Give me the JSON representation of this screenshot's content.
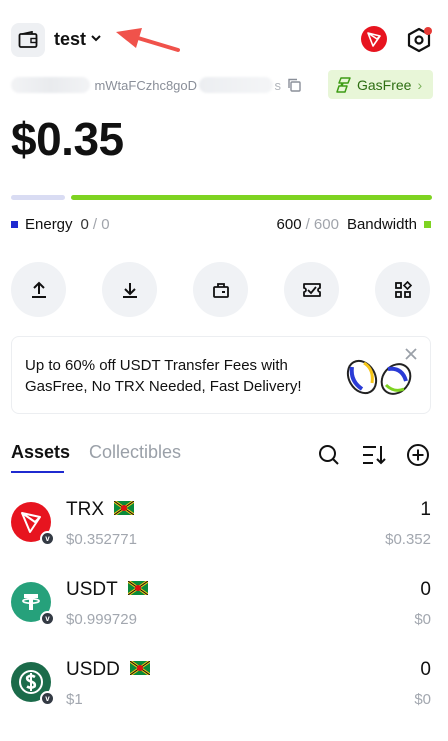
{
  "header": {
    "wallet_name": "test",
    "wallet_icon": "wallet-icon",
    "network_icon": "tron-logo",
    "settings_icon": "hexagon-settings-icon"
  },
  "address": {
    "partial": "mWtaFCzhc8goD",
    "tail": "s"
  },
  "gasfree": {
    "label": "GasFree",
    "chevron": "›"
  },
  "balance": "$0.35",
  "resources": {
    "energy_label": "Energy",
    "energy_used": "0",
    "energy_total": "/ 0",
    "bandwidth_label": "Bandwidth",
    "bandwidth_used": "600",
    "bandwidth_total": "/ 600",
    "energy_fraction": 0,
    "bandwidth_fraction": 1.0,
    "energy_color": "#1f2ad0",
    "bandwidth_color": "#7ed321"
  },
  "actions": [
    {
      "icon": "send-icon"
    },
    {
      "icon": "receive-icon"
    },
    {
      "icon": "bag-icon"
    },
    {
      "icon": "ticket-icon"
    },
    {
      "icon": "apps-icon"
    }
  ],
  "promo": {
    "text": "Up to 60% off USDT Transfer Fees with GasFree, No TRX Needed, Fast Delivery!"
  },
  "tabs": {
    "assets": "Assets",
    "collectibles": "Collectibles"
  },
  "assets": [
    {
      "symbol": "TRX",
      "price": "$0.352771",
      "amount": "1",
      "value": "$0.352",
      "logo": "trx-logo",
      "color": "#e7141f"
    },
    {
      "symbol": "USDT",
      "price": "$0.999729",
      "amount": "0",
      "value": "$0",
      "logo": "usdt-logo",
      "color": "#26a17b"
    },
    {
      "symbol": "USDD",
      "price": "$1",
      "amount": "0",
      "value": "$0",
      "logo": "usdd-logo",
      "color": "#1b6b4a"
    }
  ]
}
